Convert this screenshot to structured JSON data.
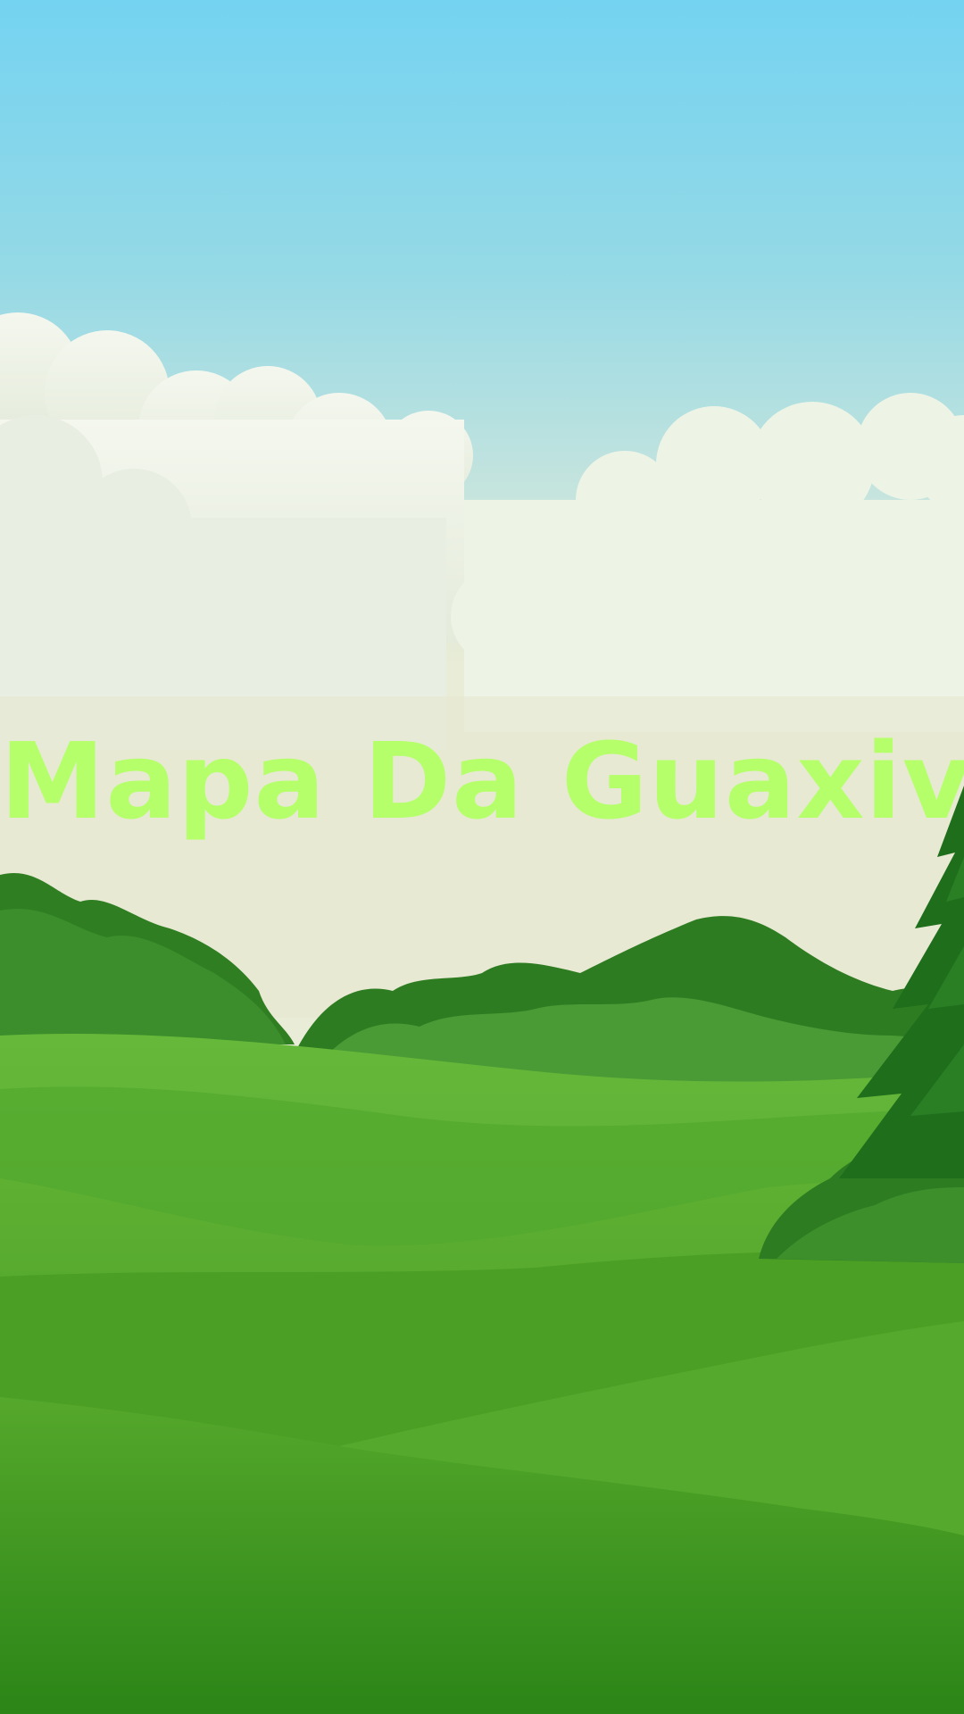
{
  "title": {
    "text": "Mapa Da Guaxiva",
    "color": "#b4ff6a"
  },
  "colors": {
    "sky_top": "#74d3f1",
    "sky_mid": "#a5dde0",
    "horizon": "#e9ecd6",
    "cloud": "#eef3e4",
    "bush_dark": "#2e7d22",
    "bush_light": "#4a9a35",
    "grass_light": "#5fb533",
    "grass_dark": "#2d8a1a",
    "tree": "#1f6e1c"
  }
}
